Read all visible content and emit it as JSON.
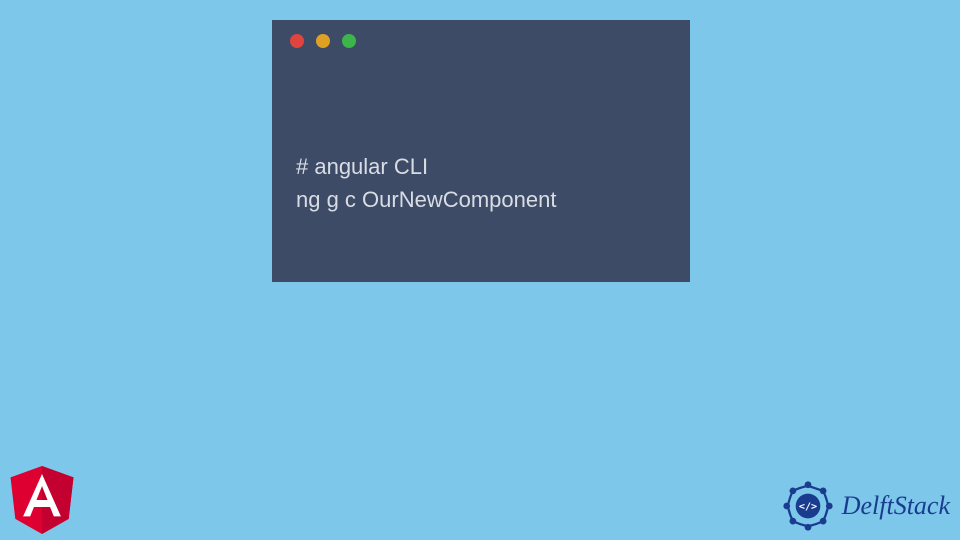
{
  "terminal": {
    "lines": [
      "# angular CLI",
      "ng g c OurNewComponent"
    ]
  },
  "colors": {
    "background": "#7cc7ea",
    "terminal_bg": "#3d4b66",
    "terminal_text": "#d8dde5",
    "traffic_red": "#e0443e",
    "traffic_yellow": "#dea123",
    "traffic_green": "#3cb64a",
    "angular_red": "#dd0031",
    "angular_dark": "#c3002f",
    "delftstack_blue": "#1a3c8f"
  },
  "logos": {
    "angular_letter": "A",
    "delftstack_label": "DelftStack",
    "delftstack_inner": "</>"
  }
}
